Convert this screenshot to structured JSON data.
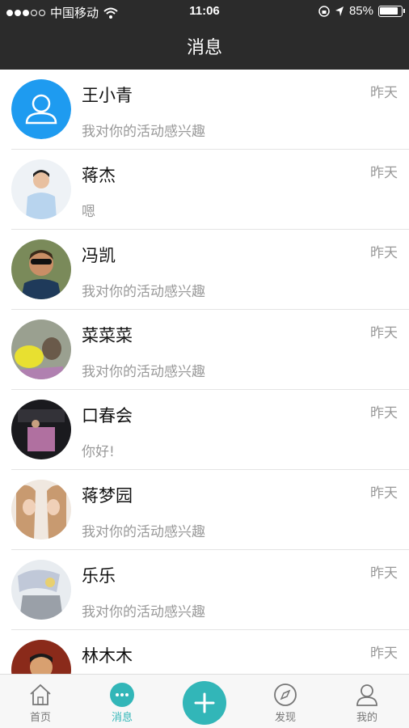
{
  "status": {
    "carrier": "中国移动",
    "time": "11:06",
    "battery": "85%"
  },
  "nav": {
    "title": "消息"
  },
  "conversations": [
    {
      "name": "王小青",
      "message": "我对你的活动感兴趣",
      "time": "昨天"
    },
    {
      "name": "蒋杰",
      "message": "嗯",
      "time": "昨天"
    },
    {
      "name": "冯凯",
      "message": "我对你的活动感兴趣",
      "time": "昨天"
    },
    {
      "name": "菜菜菜",
      "message": "我对你的活动感兴趣",
      "time": "昨天"
    },
    {
      "name": "口春会",
      "message": "你好!",
      "time": "昨天"
    },
    {
      "name": "蒋梦园",
      "message": "我对你的活动感兴趣",
      "time": "昨天"
    },
    {
      "name": "乐乐",
      "message": "我对你的活动感兴趣",
      "time": "昨天"
    },
    {
      "name": "林木木",
      "message": "",
      "time": "昨天"
    }
  ],
  "tabs": {
    "home": "首页",
    "messages": "消息",
    "discover": "发现",
    "mine": "我的"
  },
  "colors": {
    "accent": "#32b6b8",
    "default_avatar": "#1e9bf0",
    "header": "#2b2b2b"
  }
}
